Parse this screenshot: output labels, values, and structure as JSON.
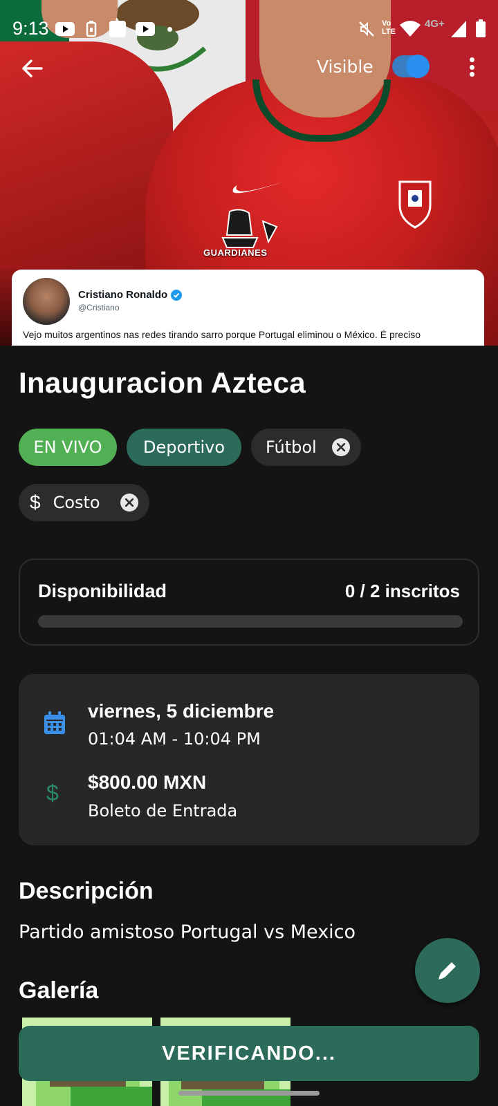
{
  "status_bar": {
    "time": "9:13",
    "network_label": "4G+",
    "volte_label": "Vo LTE",
    "icons": [
      "youtube-icon",
      "sim-icon",
      "square-icon",
      "youtube-icon",
      "dot-icon",
      "mute-icon",
      "volte-icon",
      "wifi-icon",
      "signal-icon",
      "battery-icon"
    ]
  },
  "app_bar": {
    "back_icon": "arrow-left-icon",
    "visible_label": "Visible",
    "visible_on": true,
    "menu_icon": "more-vertical-icon"
  },
  "hero": {
    "logo_text": "GUARDIANES",
    "tweet": {
      "author": "Cristiano Ronaldo",
      "handle": "@Cristiano",
      "text": "Vejo muitos argentinos nas redes tirando sarro porque Portugal eliminou o México. É preciso"
    }
  },
  "event": {
    "title": "Inauguracion Azteca",
    "chips": {
      "live": "EN VIVO",
      "category": "Deportivo",
      "sport": "Fútbol",
      "cost": "Costo"
    }
  },
  "availability": {
    "label": "Disponibilidad",
    "count_text": "0 / 2 inscritos",
    "fraction": 0
  },
  "details": {
    "date": "viernes, 5 diciembre",
    "time_range": "01:04 AM - 10:04 PM",
    "price": "$800.00 MXN",
    "ticket_type": "Boleto de Entrada",
    "calendar_icon": "calendar-icon",
    "price_icon": "dollar-icon"
  },
  "description": {
    "heading": "Descripción",
    "text": "Partido amistoso Portugal vs Mexico"
  },
  "gallery": {
    "heading": "Galería"
  },
  "fab": {
    "icon": "pencil-icon"
  },
  "action": {
    "label": "VERIFICANDO..."
  },
  "colors": {
    "background": "#141414",
    "live_green": "#52b054",
    "teal": "#2c6b5a",
    "chip_dark": "#2c2c2c",
    "card": "#272727",
    "toggle_blue": "#2c8ff0",
    "calendar_blue": "#3b8fe8",
    "price_green": "#2c6b5a"
  }
}
